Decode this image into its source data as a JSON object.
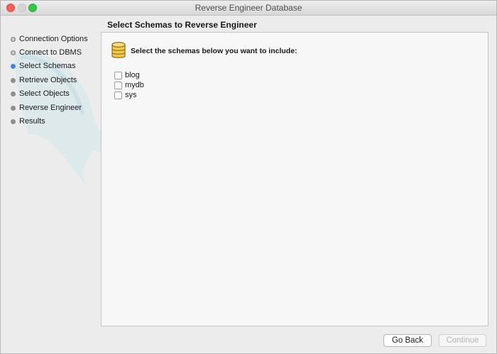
{
  "window": {
    "title": "Reverse Engineer Database"
  },
  "sidebar": {
    "steps": [
      {
        "label": "Connection Options",
        "state": "done"
      },
      {
        "label": "Connect to DBMS",
        "state": "done"
      },
      {
        "label": "Select Schemas",
        "state": "current"
      },
      {
        "label": "Retrieve Objects",
        "state": "pending"
      },
      {
        "label": "Select Objects",
        "state": "pending"
      },
      {
        "label": "Reverse Engineer",
        "state": "pending"
      },
      {
        "label": "Results",
        "state": "pending"
      }
    ]
  },
  "main": {
    "title": "Select Schemas to Reverse Engineer",
    "instruction": "Select the schemas below you want to include:",
    "icon": "database-icon",
    "schemas": [
      {
        "name": "blog",
        "checked": false
      },
      {
        "name": "mydb",
        "checked": false
      },
      {
        "name": "sys",
        "checked": false
      }
    ]
  },
  "footer": {
    "back_label": "Go Back",
    "continue_label": "Continue",
    "continue_enabled": false
  },
  "colors": {
    "current_step": "#3a86d8",
    "database_icon": "#f2c94c"
  }
}
